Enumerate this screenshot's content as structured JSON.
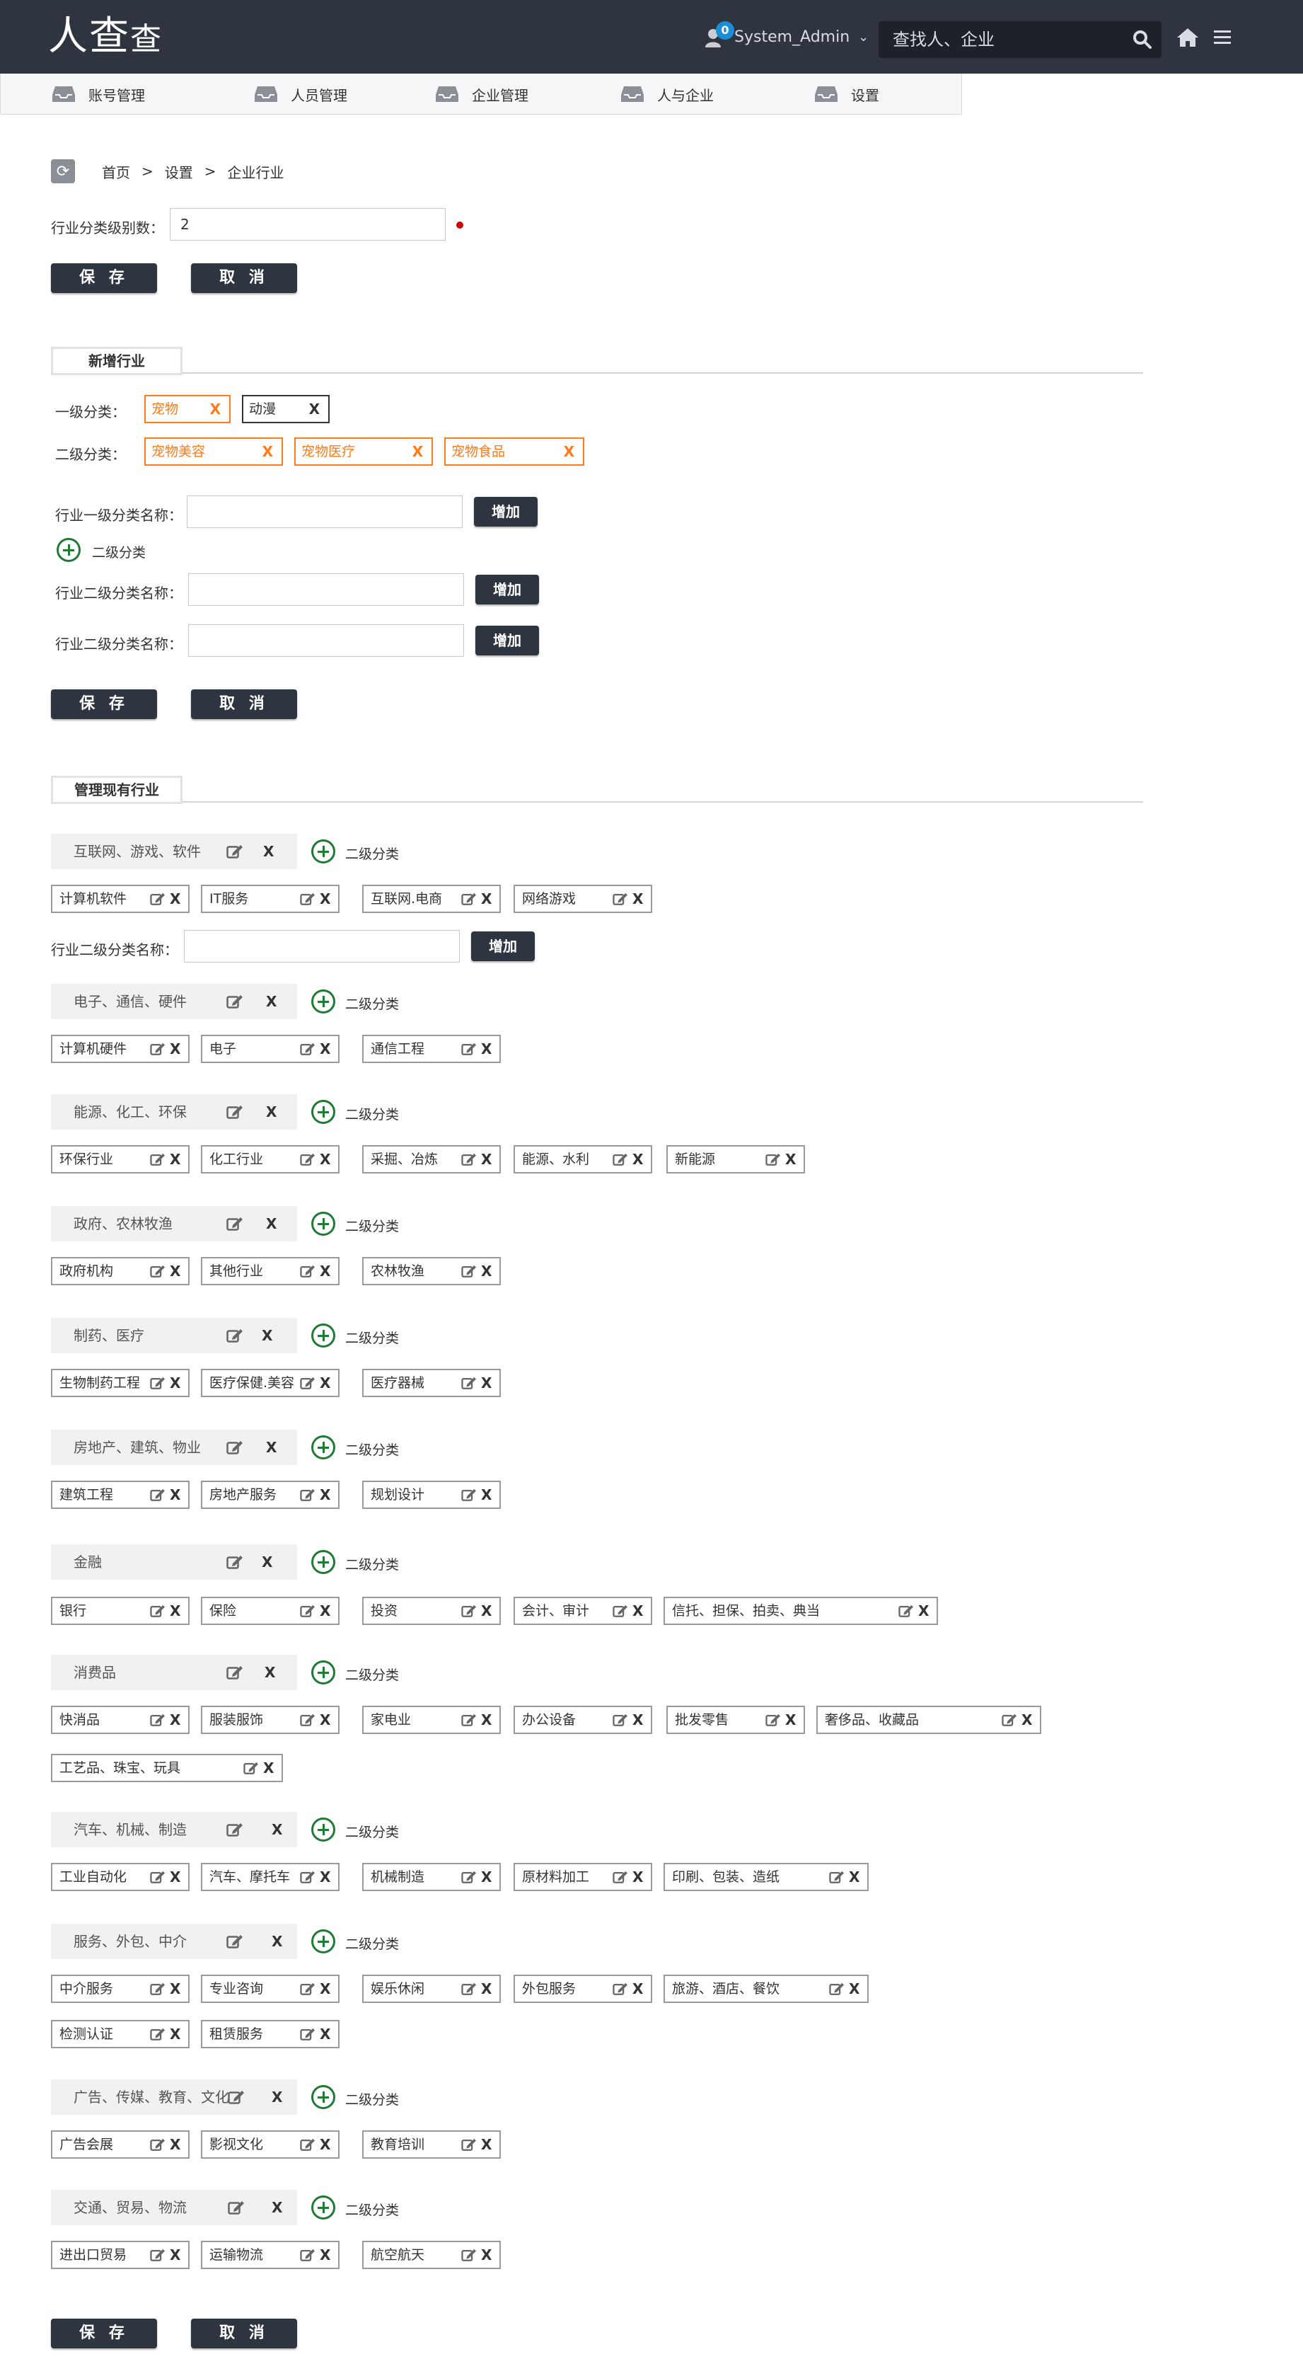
{
  "header": {
    "logo_main": "人查",
    "logo_small": "查",
    "notification_count": "0",
    "username": "System_Admin",
    "search_placeholder": "查找人、企业"
  },
  "nav": [
    "账号管理",
    "人员管理",
    "企业管理",
    "人与企业",
    "设置"
  ],
  "breadcrumb": [
    "首页",
    "设置",
    "企业行业"
  ],
  "settings": {
    "levels_label": "行业分类级别数：",
    "levels_value": "2"
  },
  "buttons": {
    "save": "保 存",
    "cancel": "取 消",
    "add": "增加"
  },
  "new_industry": {
    "title": "新增行业",
    "level1_label": "一级分类：",
    "level1_tags": [
      "宠物",
      "动漫"
    ],
    "level2_label": "二级分类：",
    "level2_tags": [
      "宠物美容",
      "宠物医疗",
      "宠物食品"
    ],
    "level1_name_label": "行业一级分类名称：",
    "add_sub_label": "二级分类",
    "level2_name_label": "行业二级分类名称："
  },
  "manage": {
    "title": "管理现有行业",
    "add_sub_label": "二级分类",
    "sub_name_label": "行业二级分类名称：",
    "categories": [
      {
        "name": "互联网、游戏、软件",
        "subs": [
          "计算机软件",
          "IT服务",
          "互联网.电商",
          "网络游戏"
        ]
      },
      {
        "name": "电子、通信、硬件",
        "subs": [
          "计算机硬件",
          "电子",
          "通信工程"
        ]
      },
      {
        "name": "能源、化工、环保",
        "subs": [
          "环保行业",
          "化工行业",
          "采掘、冶炼",
          "能源、水利",
          "新能源"
        ]
      },
      {
        "name": "政府、农林牧渔",
        "subs": [
          "政府机构",
          "其他行业",
          "农林牧渔"
        ]
      },
      {
        "name": "制药、医疗",
        "subs": [
          "生物制药工程",
          "医疗保健.美容",
          "医疗器械"
        ]
      },
      {
        "name": "房地产、建筑、物业",
        "subs": [
          "建筑工程",
          "房地产服务",
          "规划设计"
        ]
      },
      {
        "name": "金融",
        "subs": [
          "银行",
          "保险",
          "投资",
          "会计、审计",
          "信托、担保、拍卖、典当"
        ]
      },
      {
        "name": "消费品",
        "subs": [
          "快消品",
          "服装服饰",
          "家电业",
          "办公设备",
          "批发零售",
          "奢侈品、收藏品",
          "工艺品、珠宝、玩具"
        ]
      },
      {
        "name": "汽车、机械、制造",
        "subs": [
          "工业自动化",
          "汽车、摩托车",
          "机械制造",
          "原材料加工",
          "印刷、包装、造纸"
        ]
      },
      {
        "name": "服务、外包、中介",
        "subs": [
          "中介服务",
          "专业咨询",
          "娱乐休闲",
          "外包服务",
          "旅游、酒店、餐饮",
          "检测认证",
          "租赁服务"
        ]
      },
      {
        "name": "广告、传媒、教育、文化",
        "subs": [
          "广告会展",
          "影视文化",
          "教育培训"
        ]
      },
      {
        "name": "交通、贸易、物流",
        "subs": [
          "进出口贸易",
          "运输物流",
          "航空航天"
        ]
      }
    ]
  },
  "colors": {
    "header_bg": "#2e3540",
    "accent_orange": "#ff7a1a",
    "plus_green": "#1f7a34"
  }
}
